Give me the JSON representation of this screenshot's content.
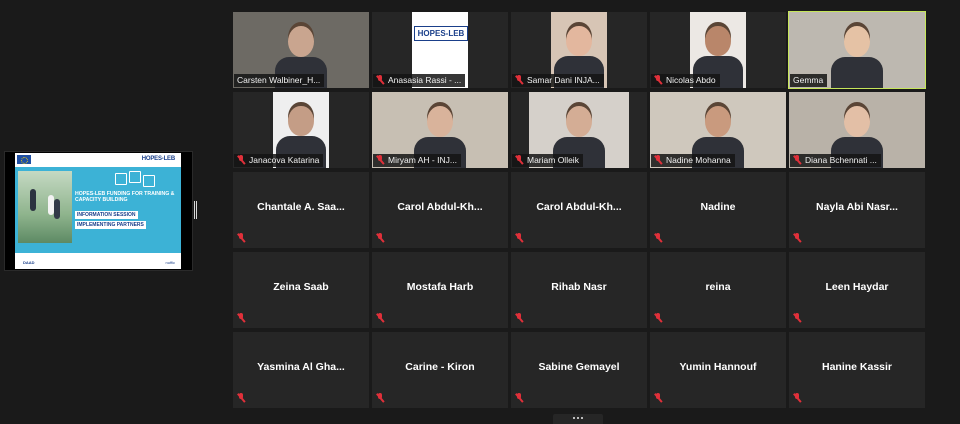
{
  "shared_screen": {
    "slide_brand": "HOPES-LEB",
    "slide_title": "HOPES-LEB FUNDING FOR TRAINING & CAPACITY BUILDING",
    "slide_chip1": "INFORMATION SESSION",
    "slide_chip2": "IMPLEMENTING PARTNERS",
    "slide_footer": "DAAD",
    "slide_footer_right": "nuffic"
  },
  "participants_video": [
    {
      "name": "Carsten Walbiner_H...",
      "muted": false,
      "speaking": false,
      "bg": "#6d6a64",
      "face": "#c9a58f"
    },
    {
      "name": "Anasasia Rassi - ...",
      "muted": true,
      "speaking": false,
      "bg": "#ffffff",
      "logo": "HOPES-LEB"
    },
    {
      "name": "Samar Dani INJA...",
      "muted": true,
      "speaking": false,
      "bg": "#d7c5b5",
      "face": "#e3b79e"
    },
    {
      "name": "Nicolas Abdo",
      "muted": true,
      "speaking": false,
      "bg": "#ece8e4",
      "face": "#b9866a"
    },
    {
      "name": "Gemma",
      "muted": false,
      "speaking": true,
      "bg": "#bdb8b0",
      "face": "#e5c2a5"
    },
    {
      "name": "Janacova Katarina",
      "muted": true,
      "speaking": false,
      "bg": "#efefef",
      "face": "#c49d86"
    },
    {
      "name": "Miryam AH - INJ...",
      "muted": true,
      "speaking": false,
      "bg": "#c7bfb3",
      "face": "#d9b39b"
    },
    {
      "name": "Mariam Olleik",
      "muted": true,
      "speaking": false,
      "bg": "#d5d0ca",
      "face": "#d4ad95"
    },
    {
      "name": "Nadine Mohanna",
      "muted": true,
      "speaking": false,
      "bg": "#cfc8bd",
      "face": "#c99a7e"
    },
    {
      "name": "Diana Bchennati ...",
      "muted": true,
      "speaking": false,
      "bg": "#b9b2a8",
      "face": "#e3bfa6"
    }
  ],
  "participants_audio": [
    "Chantale A. Saa...",
    "Carol  Abdul-Kh...",
    "Carol  Abdul-Kh...",
    "Nadine",
    "Nayla Abi Nasr...",
    "Zeina Saab",
    "Mostafa Harb",
    "Rihab Nasr",
    "reina",
    "Leen Haydar",
    "Yasmina Al Gha...",
    "Carine - Kiron",
    "Sabine Gemayel",
    "Yumin Hannouf",
    "Hanine Kassir"
  ],
  "colors": {
    "active_speaker": "#c6e65a",
    "muted_icon": "#e0303a",
    "tile_bg": "#262626",
    "app_bg": "#1a1a1a"
  }
}
